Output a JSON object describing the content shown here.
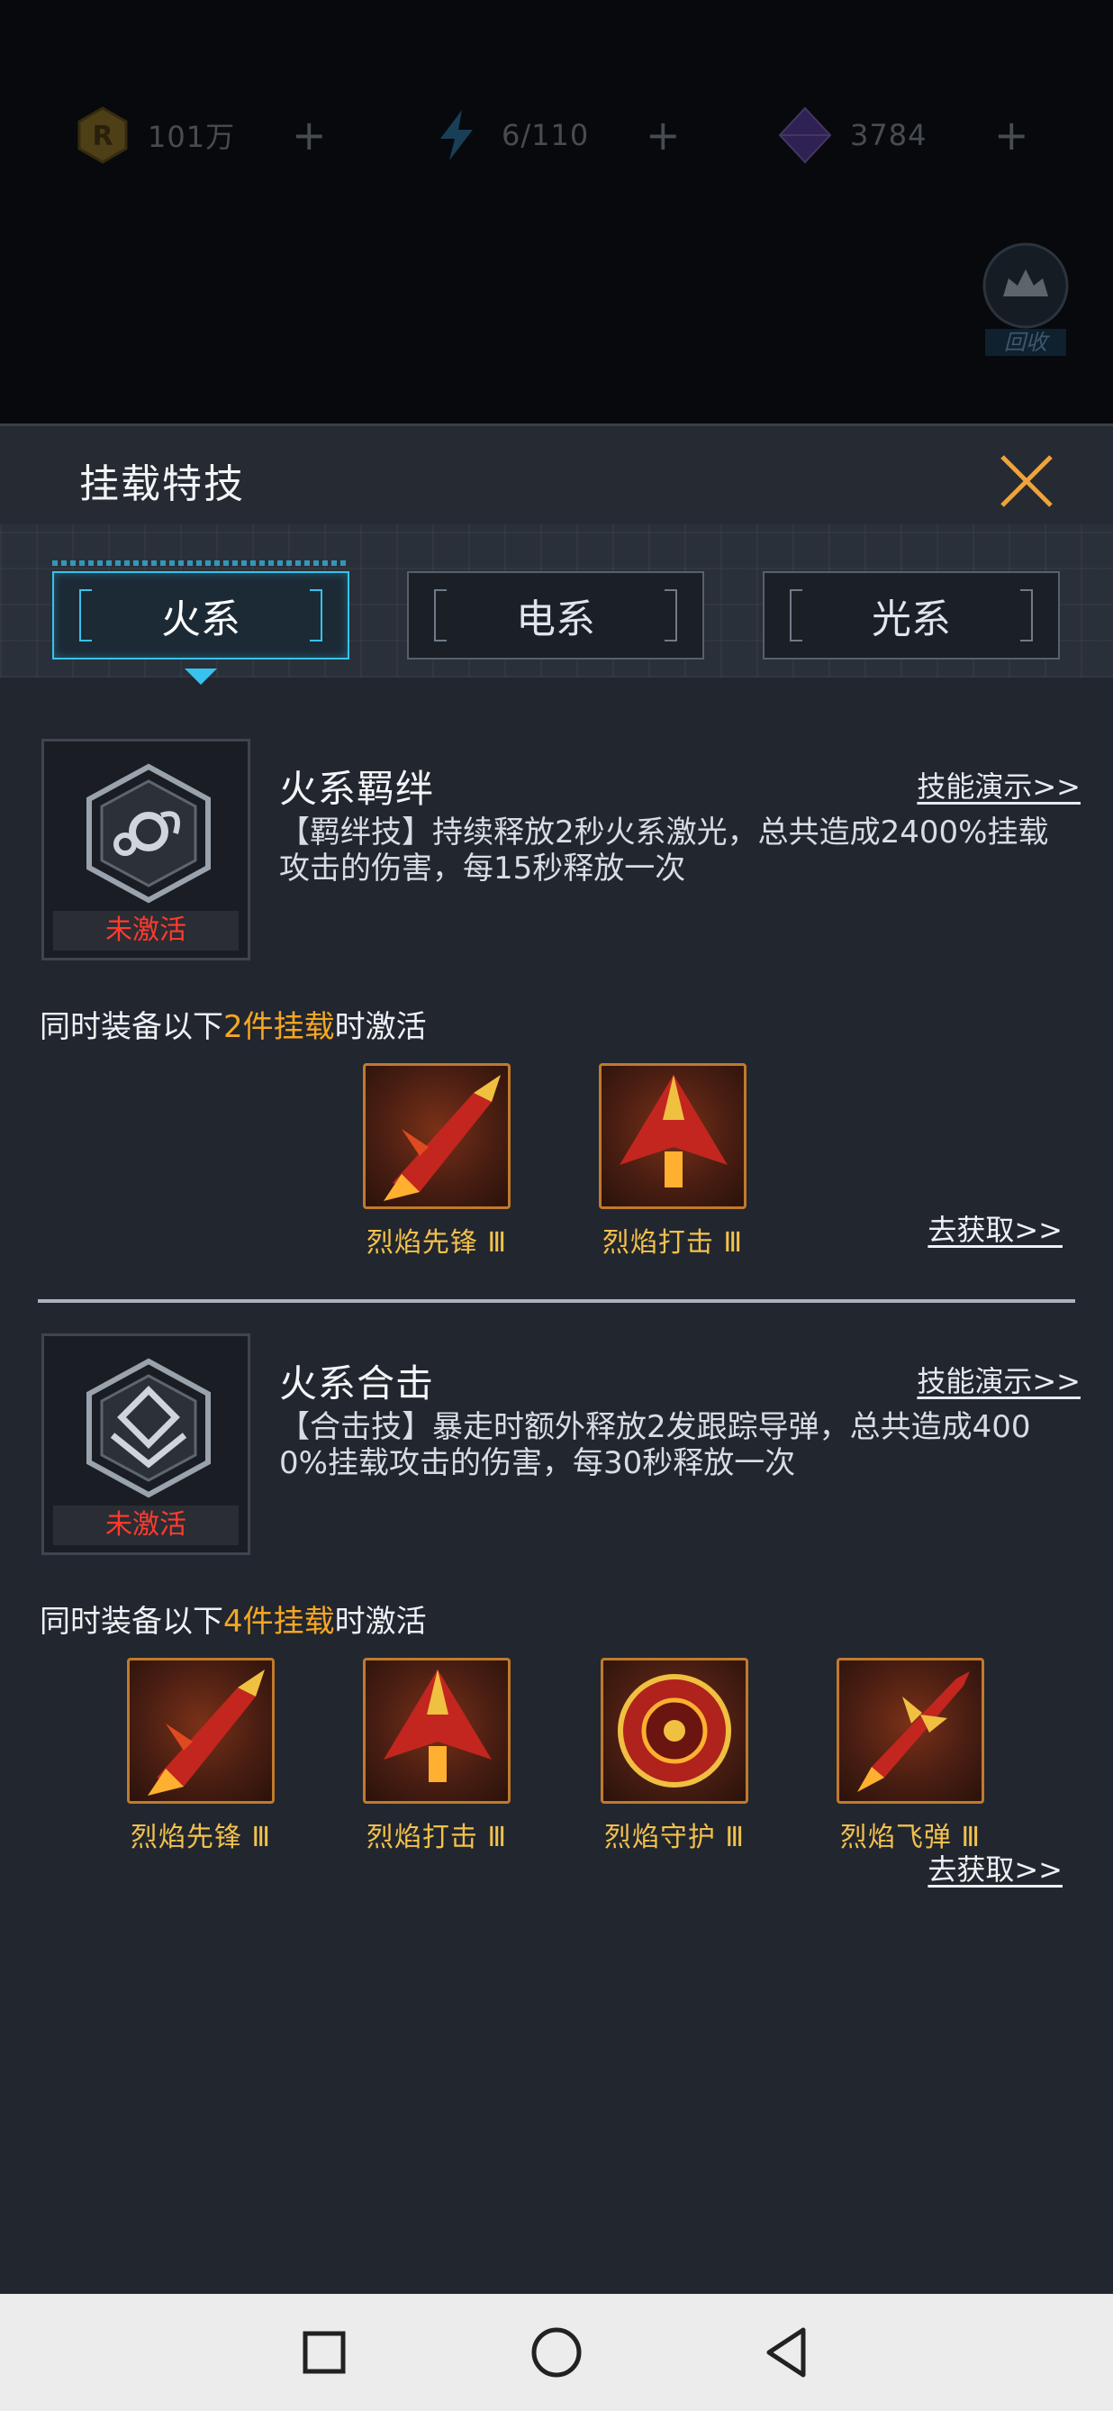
{
  "resources": [
    {
      "icon": "gold-coin-icon",
      "value": "101万",
      "plus": "+"
    },
    {
      "icon": "energy-bolt-icon",
      "value": "6/110",
      "plus": "+"
    },
    {
      "icon": "purple-crystal-icon",
      "value": "3784",
      "plus": "+"
    }
  ],
  "recycle": {
    "label": "回收"
  },
  "panel": {
    "title": "挂载特技"
  },
  "tabs": [
    {
      "label": "火系",
      "active": true
    },
    {
      "label": "电系",
      "active": false
    },
    {
      "label": "光系",
      "active": false
    }
  ],
  "skills": [
    {
      "name": "火系羁绊",
      "demo": "技能演示>>",
      "description": "【羁绊技】持续释放2秒火系激光，总共造成2400%挂载攻击的伤害，每15秒释放一次",
      "state": "未激活",
      "requirement_prefix": "同时装备以下",
      "requirement_highlight": "2件挂载",
      "requirement_suffix": "时激活",
      "items": [
        "烈焰先锋 Ⅲ",
        "烈焰打击 Ⅲ"
      ],
      "get": "去获取>>"
    },
    {
      "name": "火系合击",
      "demo": "技能演示>>",
      "description": "【合击技】暴走时额外释放2发跟踪导弹，总共造成4000%挂载攻击的伤害，每30秒释放一次",
      "state": "未激活",
      "requirement_prefix": "同时装备以下",
      "requirement_highlight": "4件挂载",
      "requirement_suffix": "时激活",
      "items": [
        "烈焰先锋 Ⅲ",
        "烈焰打击 Ⅲ",
        "烈焰守护 Ⅲ",
        "烈焰飞弹 Ⅲ"
      ],
      "get": "去获取>>"
    }
  ],
  "colors": {
    "accent": "#38c2ee",
    "highlight": "#f5a623",
    "inactive": "#ff3b30",
    "item_name": "#f2c14e"
  }
}
